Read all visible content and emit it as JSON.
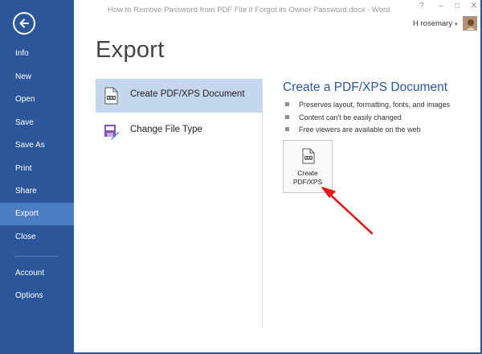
{
  "window": {
    "title": "How to Remove Password from PDF File if Forgot its Owner Password.docx - Word",
    "help_label": "?",
    "minimize_label": "–",
    "restore_label": "□",
    "close_label": "✕",
    "user_name": "H rosemary",
    "user_caret": "▾"
  },
  "nav": {
    "back_icon": "back-arrow-icon",
    "items": [
      {
        "label": "Info"
      },
      {
        "label": "New"
      },
      {
        "label": "Open"
      },
      {
        "label": "Save"
      },
      {
        "label": "Save As"
      },
      {
        "label": "Print"
      },
      {
        "label": "Share"
      },
      {
        "label": "Export",
        "selected": true
      },
      {
        "label": "Close"
      },
      {
        "label": "Account"
      },
      {
        "label": "Options"
      }
    ]
  },
  "page": {
    "title": "Export"
  },
  "options": [
    {
      "label": "Create PDF/XPS Document",
      "icon": "pdf-document-icon",
      "selected": true
    },
    {
      "label": "Change File Type",
      "icon": "file-type-icon",
      "selected": false
    }
  ],
  "detail": {
    "title": "Create a PDF/XPS Document",
    "bullets": [
      "Preserves layout, formatting, fonts, and images",
      "Content can't be easily changed",
      "Free viewers are available on the web"
    ],
    "button_line1": "Create",
    "button_line2": "PDF/XPS",
    "button_icon": "pdf-document-icon"
  },
  "colors": {
    "nav_bg": "#2b579a",
    "nav_selected": "#4c7cc2",
    "option_selected": "#c5d6ef",
    "accent_title": "#2b579a",
    "annotation_arrow": "#e01b1b"
  },
  "annotation": {
    "icon": "red-arrow-annotation"
  }
}
